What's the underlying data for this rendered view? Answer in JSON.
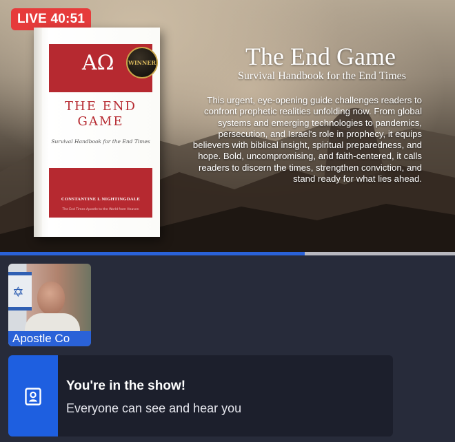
{
  "stream": {
    "live_badge": "LIVE 40:51",
    "progress": 0.67
  },
  "banner": {
    "book": {
      "alpha_omega": "AΩ",
      "winner_seal": "WINNER",
      "title": "THE END GAME",
      "subtitle": "Survival Handbook for the End Times",
      "author": "CONSTANTINE L NIGHTINGDALE",
      "tagline": "The End Times Apostle to the World from Heaven"
    },
    "title": "The End Game",
    "subtitle": "Survival Handbook for the End Times",
    "description": "This urgent, eye-opening guide challenges readers to confront prophetic realities unfolding now. From global systems and emerging technologies to pandemics, persecution, and Israel's role in prophecy, it equips believers with biblical insight, spiritual preparedness, and hope. Bold, uncompromising, and faith-centered, it calls readers to discern the times, strengthen conviction, and stand ready for what lies ahead."
  },
  "participant": {
    "name": "Apostle Co"
  },
  "notification": {
    "icon": "person-badge-icon",
    "title": "You're in the show!",
    "body": "Everyone can see and hear you"
  },
  "colors": {
    "live": "#e63b3b",
    "accent": "#2a62d8",
    "background": "#272b3a",
    "card": "#1c1f2c"
  }
}
